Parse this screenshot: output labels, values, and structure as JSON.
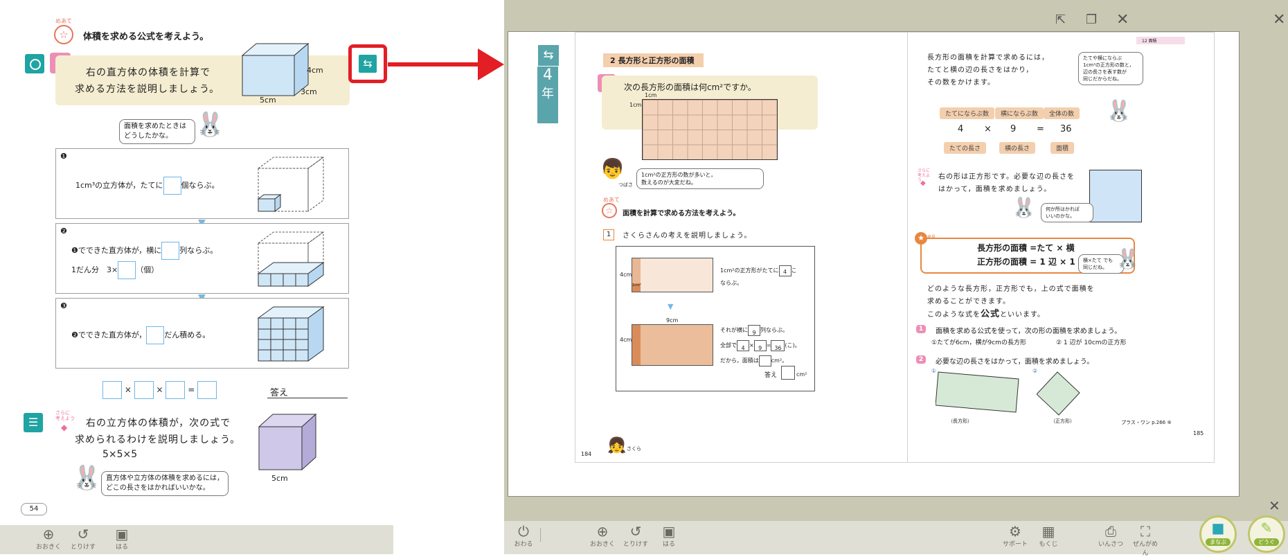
{
  "left_page": {
    "goal_tag": "めあて",
    "goal_text": "体積を求める公式を考えよう。",
    "problem_number": "2",
    "problem_text_line1": "右の直方体の体積を計算で",
    "problem_text_line2": "求める方法を説明しましょう。",
    "dim_height": "4cm",
    "dim_depth": "3cm",
    "dim_width": "5cm",
    "hint_bubble_line1": "面積を求めたときは",
    "hint_bubble_line2": "どうしたかな。",
    "step1_mark": "❶",
    "step1_text_a": "1cm³の立方体が，たてに",
    "step1_text_b": "個ならぶ。",
    "step2_mark": "❷",
    "step2_text_a": "❶でできた直方体が，横に",
    "step2_text_b": "列ならぶ。",
    "step2_line2_a": "1だん分　3×",
    "step2_line2_b": "（個）",
    "step3_mark": "❸",
    "step3_text_a": "❷でできた直方体が，",
    "step3_text_b": "だん積める。",
    "times1": "×",
    "times2": "×",
    "equals": "=",
    "answer_label": "答え",
    "extra_tag": "さらに 考えよう",
    "extra_line1": "右の立方体の体積が，次の式で",
    "extra_line2": "求められるわけを説明しましょう。",
    "extra_formula": "5×5×5",
    "extra_bubble_line1": "直方体や立方体の体積を求めるには，",
    "extra_bubble_line2": "どこの長さをはかればいいかな。",
    "cube_dim": "5cm",
    "page_number": "54",
    "link_icon": "back-link-icon"
  },
  "left_toolbar": [
    {
      "icon": "zoom-in-icon",
      "label": "おおきく"
    },
    {
      "icon": "undo-icon",
      "label": "とりけす"
    },
    {
      "icon": "image-icon",
      "label": "はる"
    }
  ],
  "viewer": {
    "window_controls": [
      "expand-icon",
      "restore-icon",
      "close-icon"
    ],
    "grade_tab": "4",
    "grade_tab2": "年",
    "left_page": {
      "section_title": "2  長方形と正方形の面積",
      "problem_number": "1",
      "problem_text": "次の長方形の面積は何cm²ですか。",
      "unit_label_top": "1cm",
      "unit_label_left": "1cm",
      "boy_bubble_line1": "1cm²の正方形の数が多いと，",
      "boy_bubble_line2": "数えるのが大変だね。",
      "boy_name": "つばさ",
      "goal_tag": "めあて",
      "goal_text": "面積を計算で求める方法を考えよう。",
      "step1_number": "1",
      "step1_text": "さくらさんの考えを説明しましょう。",
      "rect1_height": "4cm",
      "rect1_unit": "1cm²",
      "text1_a": "1cm²の正方形がたてに",
      "text1_value": "4",
      "text1_b": "こ",
      "text1_c": "ならぶ。",
      "rect2_width": "9cm",
      "rect2_height": "4cm",
      "text2_a": "それが横に",
      "text2_value": "9",
      "text2_b": "列ならぶ。",
      "text3_a": "全部で",
      "text3_v1": "4",
      "text3_times": "×",
      "text3_v2": "9",
      "text3_eq": "=",
      "text3_v3": "36",
      "text3_b": "(こ)。",
      "text4_a": "だから，面積は",
      "text4_b": "cm²。",
      "answer_label": "答え",
      "answer_unit": "cm²",
      "girl_name": "さくら",
      "page_number": "184"
    },
    "right_page": {
      "header_tab": "12 面積",
      "intro_line1": "長方形の面積を計算で求めるには，",
      "intro_line2": "たてと横の辺の長さをはかり，",
      "intro_line3": "その数をかけます。",
      "rabbit_bubble1_line1": "たてや横にならぶ",
      "rabbit_bubble1_line2": "1cm²の正方形の数と，",
      "rabbit_bubble1_line3": "辺の長さを表す数が",
      "rabbit_bubble1_line4": "同じだからだね。",
      "chip_top1": "たてにならぶ数",
      "chip_top2": "横にならぶ数",
      "chip_top3": "全体の数",
      "eq_v1": "4",
      "eq_times": "×",
      "eq_v2": "9",
      "eq_eq": "=",
      "eq_v3": "36",
      "chip_bot1": "たての長さ",
      "chip_bot2": "横の長さ",
      "chip_bot3": "面積",
      "extra_tag": "さらに 考えよう",
      "extra_line1": "右の形は正方形です。必要な辺の長さを",
      "extra_line2": "はかって，面積を求めましょう。",
      "rabbit_bubble2_line1": "何か所はかれば",
      "rabbit_bubble2_line2": "いいのかな。",
      "discovery_tag": "発見",
      "formula_line1": "長方形の面積 =たて × 横",
      "formula_line2": "正方形の面積 = 1 辺 × 1 辺",
      "rabbit_bubble3_line1": "横×たて でも",
      "rabbit_bubble3_line2": "同じだね。",
      "summary_line1": "どのような長方形，正方形でも，上の式で面積を",
      "summary_line2": "求めることができます。",
      "summary_line3a": "このような式を",
      "summary_word": "公式",
      "summary_line3b": "といいます。",
      "ex1_number": "1",
      "ex1_text": "面積を求める公式を使って，次の形の面積を求めましょう。",
      "ex1_a": "①たてが6cm，横が9cmの長方形",
      "ex1_b": "② 1 辺が 10cmの正方形",
      "ex2_number": "2",
      "ex2_text": "必要な辺の長さをはかって，面積を求めましょう。",
      "ex2_a_label": "①",
      "ex2_a_caption": "（長方形）",
      "ex2_b_label": "②",
      "ex2_b_caption": "（正方形）",
      "plus_one": "プラス・ワン p.266 ⑨",
      "page_number": "185"
    }
  },
  "viewer_toolbar_left": [
    {
      "icon": "power-icon",
      "label": "おわる"
    },
    {
      "icon": "zoom-in-icon",
      "label": "おおきく"
    },
    {
      "icon": "undo-icon",
      "label": "とりけす"
    },
    {
      "icon": "image-icon",
      "label": "はる"
    }
  ],
  "viewer_toolbar_right": [
    {
      "icon": "gear-icon",
      "label": "サポート"
    },
    {
      "icon": "grid-icon",
      "label": "もくじ"
    },
    {
      "icon": "print-icon",
      "label": "いんさつ"
    },
    {
      "icon": "fullscreen-icon",
      "label": "ぜんがめん"
    }
  ],
  "big_buttons": [
    {
      "icon": "cube-icon",
      "label": "まなぶ"
    },
    {
      "icon": "pencil-icon",
      "label": "どうぐ"
    }
  ],
  "colors": {
    "accent_red": "#e31e24",
    "teal": "#1fa3a3",
    "viewer_bg": "#c9c8b2",
    "problem_bg": "#f5edd1",
    "pink": "#ec8fb6"
  }
}
